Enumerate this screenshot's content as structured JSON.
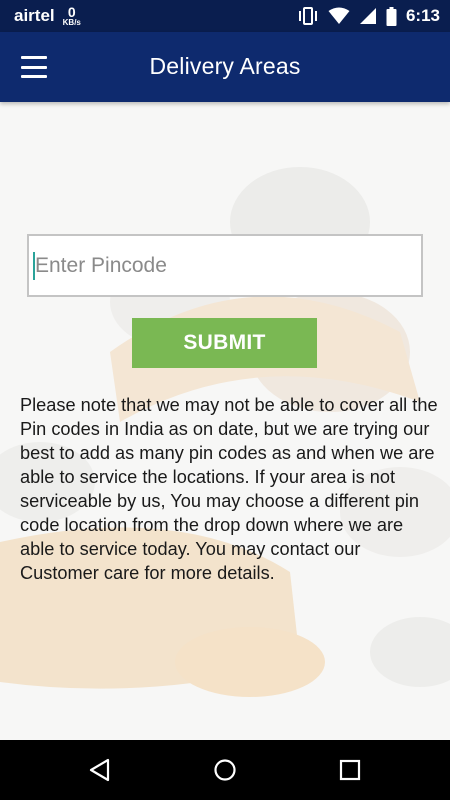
{
  "status_bar": {
    "carrier": "airtel",
    "net_speed_value": "0",
    "net_speed_unit": "KB/s",
    "time": "6:13",
    "icons": [
      "vibrate-icon",
      "wifi-icon",
      "signal-icon",
      "battery-icon"
    ]
  },
  "app_bar": {
    "title": "Delivery Areas",
    "menu_icon": "hamburger-menu-icon"
  },
  "form": {
    "pincode_value": "",
    "pincode_placeholder": "Enter Pincode",
    "submit_label": "SUBMIT"
  },
  "note": "Please note that we may not be able to cover all the Pin codes in India as on date, but we are trying our best to add as many pin codes as and when we are able to service the locations. If your area is not serviceable by us, You may choose a different pin code location from the drop down where we are able to service today. You may contact our Customer care for more details.",
  "nav_bar": {
    "icons": [
      "back-icon",
      "home-icon",
      "recents-icon"
    ]
  },
  "colors": {
    "status_bar": "#0a1e4f",
    "app_bar": "#0e2a6e",
    "submit": "#7ab853",
    "nav_bar": "#000000"
  }
}
